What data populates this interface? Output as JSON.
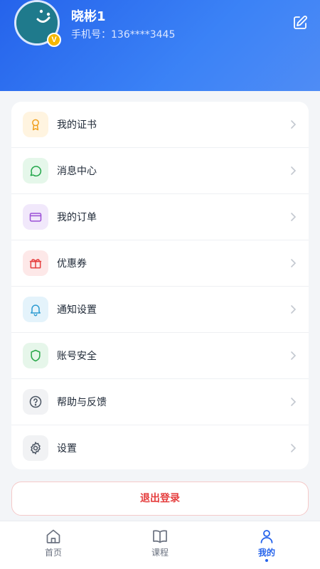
{
  "profile": {
    "username": "晓彬1",
    "phone_label": "手机号：",
    "phone": "136****3445",
    "vip_badge": "V",
    "avatar_icon": "smiley-avatar-icon",
    "edit_icon": "edit-icon"
  },
  "menu": {
    "items": [
      {
        "label": "我的证书",
        "icon": "award-icon",
        "bg": "#fff4e0",
        "color": "#f0a020"
      },
      {
        "label": "消息中心",
        "icon": "chat-bubble-icon",
        "bg": "#e5f7ea",
        "color": "#22a64a"
      },
      {
        "label": "我的订单",
        "icon": "card-icon",
        "bg": "#f1e8fb",
        "color": "#9b4fd6"
      },
      {
        "label": "优惠券",
        "icon": "gift-icon",
        "bg": "#fde8e8",
        "color": "#e53e3e"
      },
      {
        "label": "通知设置",
        "icon": "bell-icon",
        "bg": "#e4f3fb",
        "color": "#2b9bd1"
      },
      {
        "label": "账号安全",
        "icon": "shield-icon",
        "bg": "#e6f6ea",
        "color": "#2aa84a"
      },
      {
        "label": "帮助与反馈",
        "icon": "help-circle-icon",
        "bg": "#f1f2f4",
        "color": "#4b5563"
      },
      {
        "label": "设置",
        "icon": "gear-icon",
        "bg": "#f1f2f4",
        "color": "#4b5563"
      }
    ]
  },
  "logout_label": "退出登录",
  "tabbar": {
    "tabs": [
      {
        "label": "首页",
        "icon": "home-icon",
        "active": false
      },
      {
        "label": "课程",
        "icon": "book-icon",
        "active": false
      },
      {
        "label": "我的",
        "icon": "user-icon",
        "active": true
      }
    ]
  },
  "colors": {
    "accent": "#2563eb",
    "danger": "#e53e3e"
  }
}
